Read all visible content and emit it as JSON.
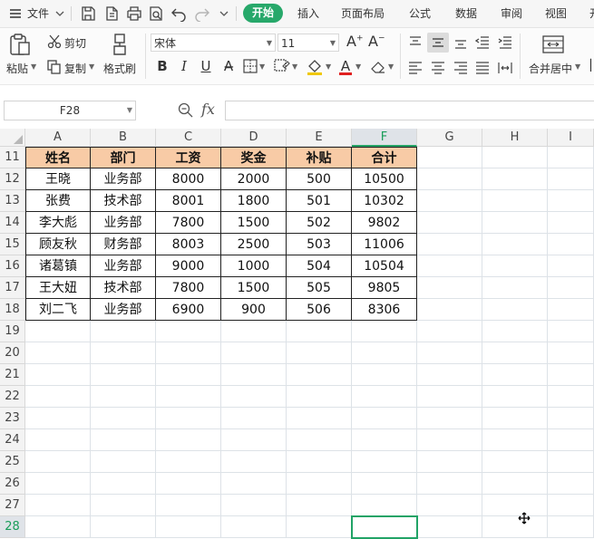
{
  "menubar": {
    "hamburger_icon": "hamburger-icon",
    "file_label": "文件",
    "tabs": [
      {
        "label": "开始",
        "active": true
      },
      {
        "label": "插入"
      },
      {
        "label": "页面布局"
      },
      {
        "label": "公式"
      },
      {
        "label": "数据"
      },
      {
        "label": "审阅"
      },
      {
        "label": "视图"
      }
    ],
    "overflow_label": "开"
  },
  "ribbon": {
    "paste_label": "粘贴",
    "cut_label": "剪切",
    "copy_label": "复制",
    "format_painter_label": "格式刷",
    "font_name": "宋体",
    "font_size": "11",
    "merge_label": "合并居中"
  },
  "formula_bar": {
    "name_box": "F28",
    "fx_label": "fx",
    "formula": ""
  },
  "grid": {
    "columns": [
      "A",
      "B",
      "C",
      "D",
      "E",
      "F",
      "G",
      "H",
      "I"
    ],
    "selected_column": "F",
    "rows": [
      "11",
      "12",
      "13",
      "14",
      "15",
      "16",
      "17",
      "18",
      "19",
      "20",
      "21",
      "22",
      "23",
      "24",
      "25",
      "26",
      "27",
      "28"
    ],
    "selected_row": "28",
    "active_cell": "F28",
    "accent_color": "#21a366",
    "header_fill": "#f8cba6"
  },
  "table": {
    "headers": [
      "姓名",
      "部门",
      "工资",
      "奖金",
      "补贴",
      "合计"
    ],
    "rows": [
      [
        "王晓",
        "业务部",
        "8000",
        "2000",
        "500",
        "10500"
      ],
      [
        "张费",
        "技术部",
        "8001",
        "1800",
        "501",
        "10302"
      ],
      [
        "李大彪",
        "业务部",
        "7800",
        "1500",
        "502",
        "9802"
      ],
      [
        "顾友秋",
        "财务部",
        "8003",
        "2500",
        "503",
        "11006"
      ],
      [
        "诸葛镇",
        "业务部",
        "9000",
        "1000",
        "504",
        "10504"
      ],
      [
        "王大妞",
        "技术部",
        "7800",
        "1500",
        "505",
        "9805"
      ],
      [
        "刘二飞",
        "业务部",
        "6900",
        "900",
        "506",
        "8306"
      ]
    ]
  }
}
